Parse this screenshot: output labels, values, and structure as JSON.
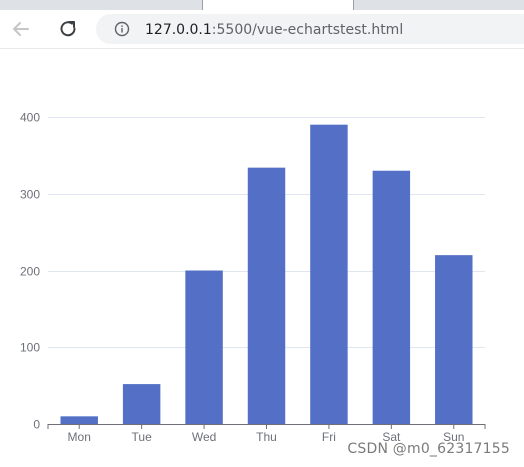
{
  "browser": {
    "url_host": "127.0.0.1",
    "url_rest": ":5500/vue-echartstest.html"
  },
  "chart_data": {
    "type": "bar",
    "categories": [
      "Mon",
      "Tue",
      "Wed",
      "Thu",
      "Fri",
      "Sat",
      "Sun"
    ],
    "values": [
      10,
      52,
      200,
      334,
      390,
      330,
      220
    ],
    "ylim": [
      0,
      400
    ],
    "yticks": [
      0,
      100,
      200,
      300,
      400
    ],
    "grid": "horizontal",
    "bar_color": "#5470c6",
    "title": "",
    "xlabel": "",
    "ylabel": ""
  },
  "watermark": "CSDN @m0_62317155"
}
